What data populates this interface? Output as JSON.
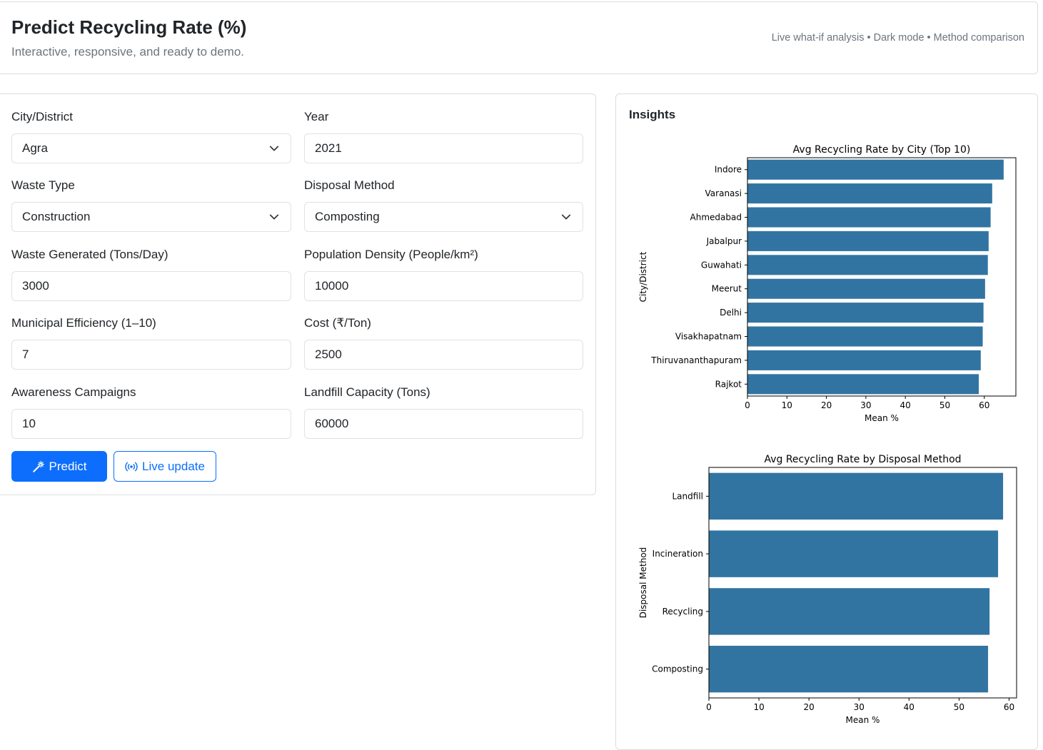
{
  "header": {
    "title": "Predict Recycling Rate (%)",
    "subtitle": "Interactive, responsive, and ready to demo.",
    "features": "Live what-if analysis • Dark mode • Method comparison"
  },
  "form": {
    "city": {
      "label": "City/District",
      "value": "Agra"
    },
    "year": {
      "label": "Year",
      "value": "2021"
    },
    "waste_type": {
      "label": "Waste Type",
      "value": "Construction"
    },
    "disposal_method": {
      "label": "Disposal Method",
      "value": "Composting"
    },
    "waste_generated": {
      "label": "Waste Generated (Tons/Day)",
      "value": "3000"
    },
    "population_density": {
      "label": "Population Density (People/km²)",
      "value": "10000"
    },
    "municipal_efficiency": {
      "label": "Municipal Efficiency (1–10)",
      "value": "7"
    },
    "cost": {
      "label": "Cost (₹/Ton)",
      "value": "2500"
    },
    "awareness_campaigns": {
      "label": "Awareness Campaigns",
      "value": "10"
    },
    "landfill_capacity": {
      "label": "Landfill Capacity (Tons)",
      "value": "60000"
    },
    "predict_label": "Predict",
    "live_update_label": "Live update"
  },
  "insights": {
    "title": "Insights"
  },
  "colors": {
    "primary": "#0d6efd",
    "bar": "#3274a1"
  },
  "chart_data": [
    {
      "type": "bar",
      "orientation": "horizontal",
      "title": "Avg Recycling Rate by City (Top 10)",
      "xlabel": "Mean %",
      "ylabel": "City/District",
      "categories": [
        "Indore",
        "Varanasi",
        "Ahmedabad",
        "Jabalpur",
        "Guwahati",
        "Meerut",
        "Delhi",
        "Visakhapatnam",
        "Thiruvananthapuram",
        "Rajkot"
      ],
      "values": [
        64.9,
        62.0,
        61.6,
        61.1,
        60.9,
        60.2,
        59.8,
        59.6,
        59.1,
        58.6
      ],
      "xlim": [
        0,
        68
      ],
      "xticks": [
        0,
        10,
        20,
        30,
        40,
        50,
        60
      ],
      "grid": false
    },
    {
      "type": "bar",
      "orientation": "horizontal",
      "title": "Avg Recycling Rate by Disposal Method",
      "xlabel": "Mean %",
      "ylabel": "Disposal Method",
      "categories": [
        "Landfill",
        "Incineration",
        "Recycling",
        "Composting"
      ],
      "values": [
        58.8,
        57.8,
        56.1,
        55.8
      ],
      "xlim": [
        0,
        61.5
      ],
      "xticks": [
        0,
        10,
        20,
        30,
        40,
        50,
        60
      ],
      "grid": false
    }
  ]
}
